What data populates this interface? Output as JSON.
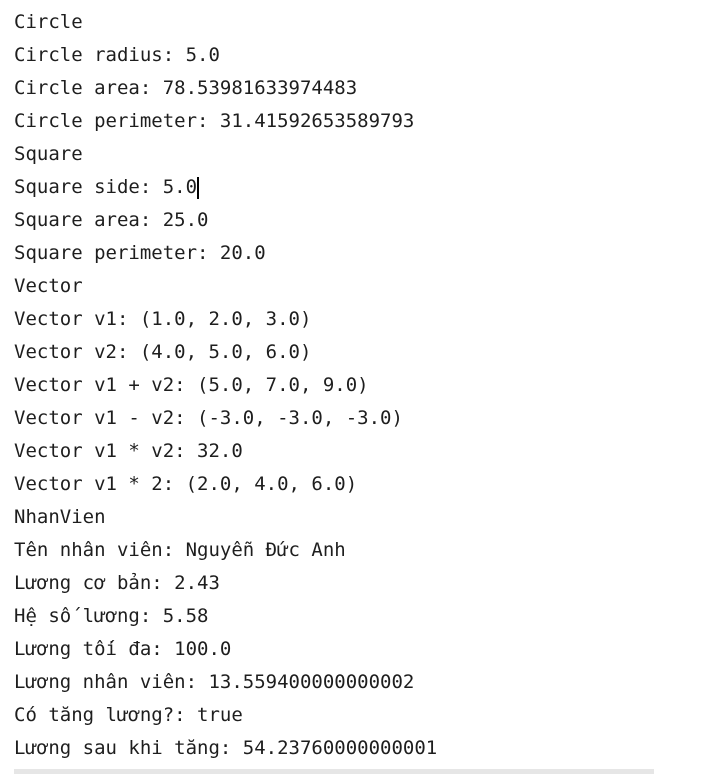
{
  "console": {
    "lines": [
      "Circle",
      "Circle radius: 5.0",
      "Circle area: 78.53981633974483",
      "Circle perimeter: 31.41592653589793",
      "Square",
      "Square side: 5.0",
      "Square area: 25.0",
      "Square perimeter: 20.0",
      "Vector",
      "Vector v1: (1.0, 2.0, 3.0)",
      "Vector v2: (4.0, 5.0, 6.0)",
      "Vector v1 + v2: (5.0, 7.0, 9.0)",
      "Vector v1 - v2: (-3.0, -3.0, -3.0)",
      "Vector v1 * v2: 32.0",
      "Vector v1 * 2: (2.0, 4.0, 6.0)",
      "NhanVien",
      "Tên nhân viên: Nguyễn Đức Anh",
      "Lương cơ bản: 2.43",
      "Hệ số lương: 5.58",
      "Lương tối đa: 100.0",
      "Lương nhân viên: 13.559400000000002",
      "Có tăng lương?: true",
      "Lương sau khi tăng: 54.23760000000001"
    ]
  }
}
